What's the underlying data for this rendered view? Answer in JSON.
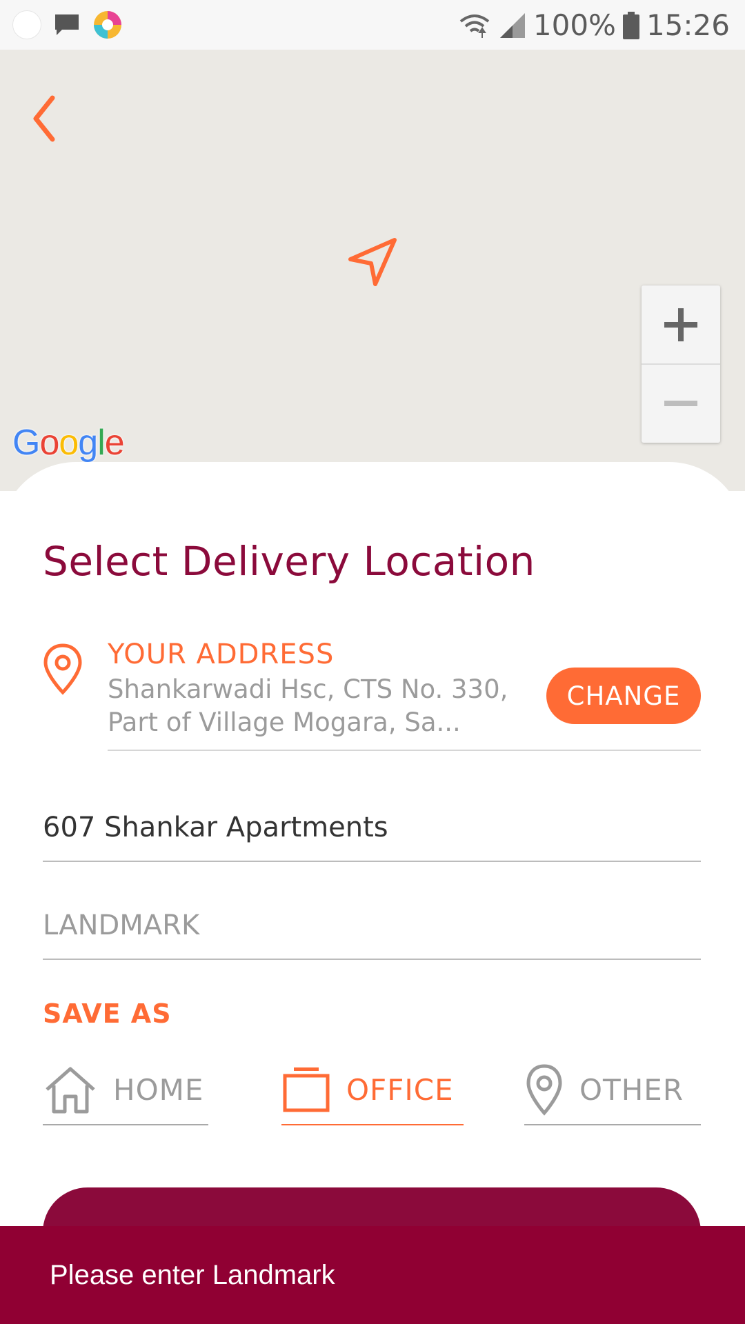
{
  "status_bar": {
    "battery": "100%",
    "time": "15:26"
  },
  "map": {
    "google_logo": "Google"
  },
  "sheet": {
    "title": "Select Delivery Location",
    "address_label": "YOUR ADDRESS",
    "address_text": "Shankarwadi Hsc, CTS No. 330, Part of Village Mogara, Sa...",
    "change_label": "CHANGE",
    "flat_value": "607 Shankar Apartments",
    "landmark_placeholder": "LANDMARK",
    "save_as_label": "SAVE AS",
    "options": {
      "home": "HOME",
      "office": "OFFICE",
      "other": "OTHER"
    },
    "selected_option": "OFFICE"
  },
  "snackbar": {
    "message": "Please enter Landmark"
  },
  "colors": {
    "accent": "#ff6b35",
    "brand": "#8b0a3b",
    "snackbar": "#900033",
    "muted": "#9b9b9b"
  },
  "icons": [
    "chat-icon",
    "app-icon",
    "wifi-icon",
    "signal-icon",
    "battery-icon",
    "back-icon",
    "navigation-icon",
    "zoom-in-icon",
    "zoom-out-icon",
    "location-pin-icon",
    "home-icon",
    "office-icon",
    "other-pin-icon"
  ]
}
